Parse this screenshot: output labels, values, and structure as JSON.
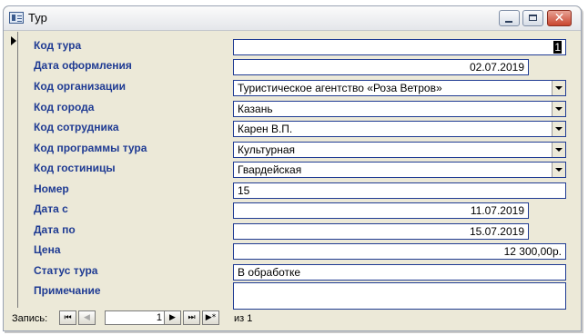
{
  "window": {
    "title": "Тур",
    "icons": {
      "app": "form-icon",
      "minimize": "minimize-icon",
      "maximize": "maximize-icon",
      "close": "close-icon"
    }
  },
  "form": {
    "fields": [
      {
        "label": "Код тура",
        "value": "1",
        "type": "text-cursor"
      },
      {
        "label": "Дата оформления",
        "value": "02.07.2019",
        "type": "date"
      },
      {
        "label": "Код организации",
        "value": "Туристическое агентство «Роза Ветров»",
        "type": "combo"
      },
      {
        "label": "Код города",
        "value": "Казань",
        "type": "combo"
      },
      {
        "label": "Код сотрудника",
        "value": "Карен В.П.",
        "type": "combo"
      },
      {
        "label": "Код программы тура",
        "value": "Культурная",
        "type": "combo"
      },
      {
        "label": "Код гостиницы",
        "value": "Гвардейская",
        "type": "combo"
      },
      {
        "label": "Номер",
        "value": "15",
        "type": "text"
      },
      {
        "label": "Дата с",
        "value": "11.07.2019",
        "type": "date"
      },
      {
        "label": "Дата по",
        "value": "15.07.2019",
        "type": "date"
      },
      {
        "label": "Цена",
        "value": "12 300,00р.",
        "type": "number"
      },
      {
        "label": "Статус тура",
        "value": "В обработке",
        "type": "text"
      },
      {
        "label": "Примечание",
        "value": "",
        "type": "memo"
      }
    ]
  },
  "navigation": {
    "label": "Запись:",
    "current": "1",
    "of_text": "из  1",
    "buttons": {
      "first": "⏮",
      "prev": "◀",
      "next": "▶",
      "last": "⏭",
      "new": "▶*"
    }
  },
  "colors": {
    "label": "#1f3b93",
    "border": "#1f3b93",
    "background": "#ece9d8"
  }
}
